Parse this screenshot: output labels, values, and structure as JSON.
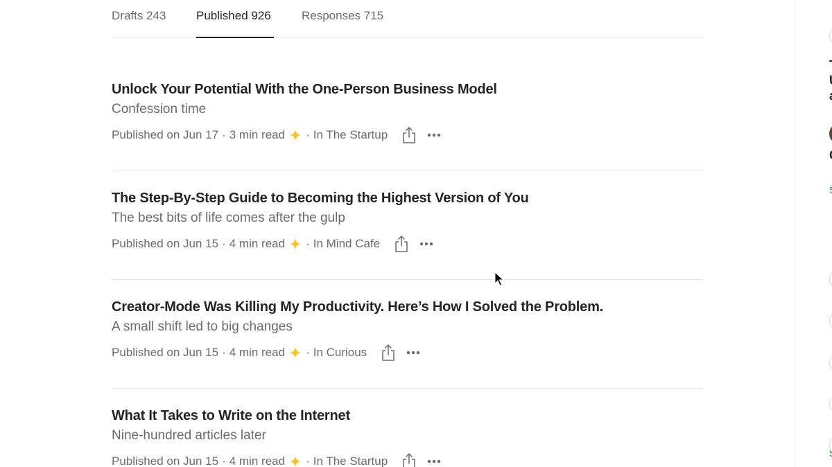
{
  "tabs": [
    {
      "label": "Drafts 243",
      "active": false
    },
    {
      "label": "Published 926",
      "active": true
    },
    {
      "label": "Responses 715",
      "active": false
    }
  ],
  "stories": [
    {
      "title": "Unlock Your Potential With the One-Person Business Model",
      "subtitle": "Confession time",
      "published": "Published on Jun 17",
      "read_time": "3 min read",
      "publication": "In The Startup"
    },
    {
      "title": "The Step-By-Step Guide to Becoming the Highest Version of You",
      "subtitle": "The best bits of life comes after the gulp",
      "published": "Published on Jun 15",
      "read_time": "4 min read",
      "publication": "In Mind Cafe"
    },
    {
      "title": "Creator-Mode Was Killing My Productivity. Here’s How I Solved the Problem.",
      "subtitle": "A small shift led to big changes",
      "published": "Published on Jun 15",
      "read_time": "4 min read",
      "publication": "In Curious"
    },
    {
      "title": "What It Takes to Write on the Internet",
      "subtitle": "Nine-hundred articles later",
      "published": "Published on Jun 15",
      "read_time": "4 min read",
      "publication": "In The Startup"
    }
  ],
  "meta_separator": "·",
  "icons": {
    "member_star": "star-icon",
    "share": "share-icon",
    "more": "more-icon"
  },
  "colors": {
    "text_primary": "#242424",
    "text_secondary": "#6b6b6b",
    "star": "#ffc017",
    "divider": "#e6e6e6",
    "accent_green": "#1a8917"
  },
  "sidebar_fragments": [
    "T",
    "U",
    "a",
    "C",
    "S",
    "S"
  ]
}
